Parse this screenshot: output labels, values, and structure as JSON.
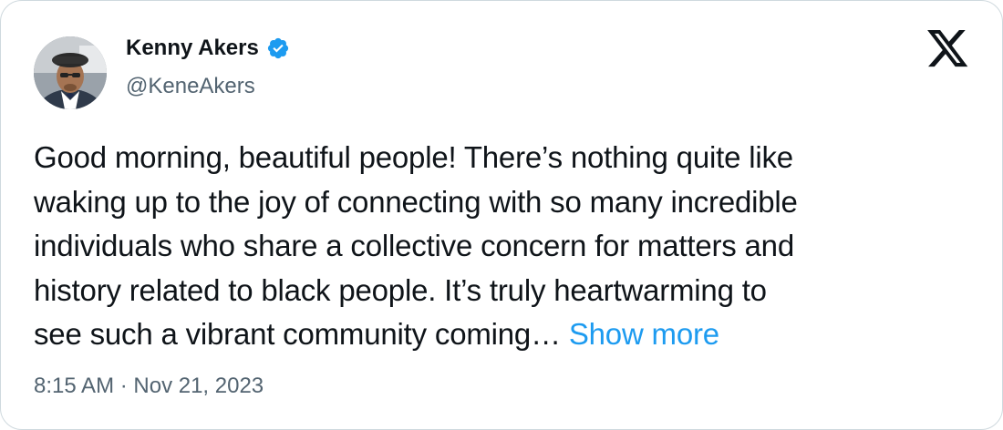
{
  "author": {
    "display_name": "Kenny Akers",
    "handle": "@KeneAkers",
    "verified": true
  },
  "brand": {
    "logo_icon": "x-logo-icon"
  },
  "tweet": {
    "text": "Good morning, beautiful people! There’s nothing quite like\nwaking up to the joy of connecting with so many incredible\nindividuals who share a collective concern for matters and\nhistory related to black people. It’s truly heartwarming to\nsee such a vibrant community coming… ",
    "show_more_label": "Show more",
    "timestamp": "8:15 AM · Nov 21, 2023"
  },
  "colors": {
    "text_primary": "#0f1419",
    "text_secondary": "#536471",
    "link": "#1d9bf0",
    "verified_badge": "#1d9bf0",
    "border": "#cfd9de"
  }
}
